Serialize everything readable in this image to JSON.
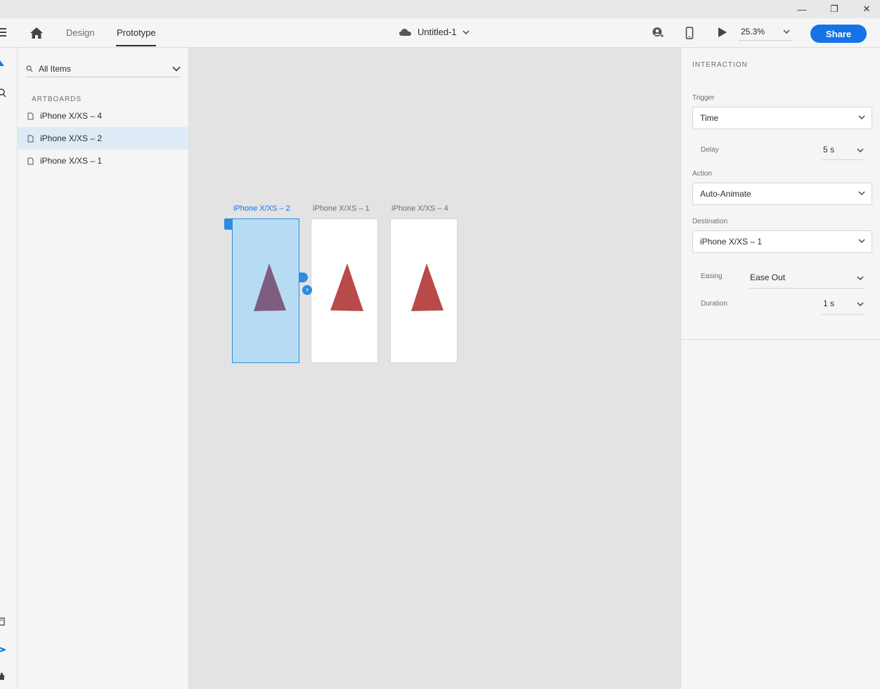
{
  "window": {
    "controls": {
      "minimize": "—",
      "restore": "❐",
      "close": "✕"
    }
  },
  "toolbar": {
    "tabs": [
      {
        "label": "Design",
        "active": false
      },
      {
        "label": "Prototype",
        "active": true
      }
    ],
    "document_title": "Untitled-1",
    "zoom": "25.3%",
    "share_label": "Share"
  },
  "layers": {
    "search_placeholder": "All Items",
    "section_label": "ARTBOARDS",
    "items": [
      {
        "label": "iPhone X/XS – 4",
        "selected": false
      },
      {
        "label": "iPhone X/XS – 2",
        "selected": true
      },
      {
        "label": "iPhone X/XS – 1",
        "selected": false
      }
    ]
  },
  "canvas": {
    "artboards": [
      {
        "label": "iPhone X/XS – 2",
        "selected": true,
        "triangle_color": "#7e5d80"
      },
      {
        "label": "iPhone X/XS – 1",
        "selected": false,
        "triangle_color": "#b94a4a"
      },
      {
        "label": "iPhone X/XS – 4",
        "selected": false,
        "triangle_color": "#b94a4a"
      }
    ]
  },
  "interaction": {
    "title": "INTERACTION",
    "trigger": {
      "label": "Trigger",
      "value": "Time"
    },
    "delay": {
      "label": "Delay",
      "value": "5 s"
    },
    "action": {
      "label": "Action",
      "value": "Auto-Animate"
    },
    "destination": {
      "label": "Destination",
      "value": "iPhone X/XS – 1"
    },
    "easing": {
      "label": "Easing",
      "value": "Ease Out"
    },
    "duration": {
      "label": "Duration",
      "value": "1 s"
    }
  },
  "colors": {
    "accent": "#1473e6",
    "selection": "#2d8ce0"
  }
}
